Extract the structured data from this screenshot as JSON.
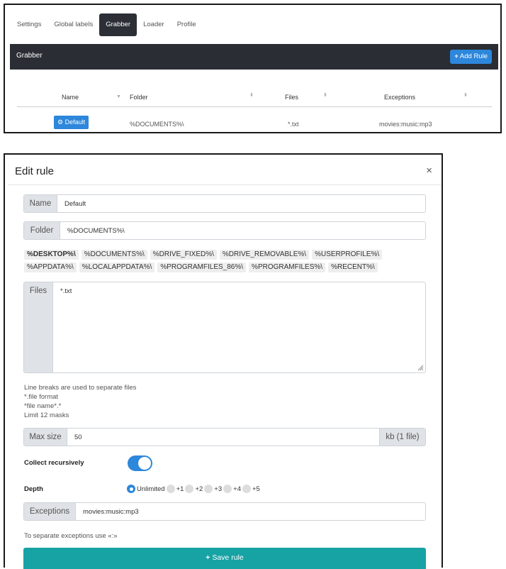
{
  "tabs": [
    "Settings",
    "Global labels",
    "Grabber",
    "Loader",
    "Profile"
  ],
  "active_tab": "Grabber",
  "panel": {
    "title": "Grabber",
    "add_rule": "Add Rule"
  },
  "table": {
    "columns": [
      "Name",
      "Folder",
      "Files",
      "Exceptions"
    ],
    "rows": [
      {
        "name": "Default",
        "folder": "%DOCUMENTS%\\",
        "files": "*.txt",
        "exceptions": "movies:music:mp3"
      }
    ]
  },
  "modal": {
    "title": "Edit rule",
    "close": "×",
    "name_label": "Name",
    "name_value": "Default",
    "folder_label": "Folder",
    "folder_value": "%DOCUMENTS%\\",
    "variables": [
      "%DESKTOP%\\",
      "%DOCUMENTS%\\",
      "%DRIVE_FIXED%\\",
      "%DRIVE_REMOVABLE%\\",
      "%USERPROFILE%\\",
      "%APPDATA%\\",
      "%LOCALAPPDATA%\\",
      "%PROGRAMFILES_86%\\",
      "%PROGRAMFILES%\\",
      "%RECENT%\\"
    ],
    "files_label": "Files",
    "files_value": "*.txt",
    "files_help": [
      "Line breaks are used to separate files",
      "*.file format",
      "*file name*.*",
      "Limit 12 masks"
    ],
    "max_size_label": "Max size",
    "max_size_value": "50",
    "max_size_unit": "kb (1 file)",
    "collect_label": "Collect recursively",
    "collect_on": true,
    "depth_label": "Depth",
    "depth_options": [
      "Unlimited",
      "+1",
      "+2",
      "+3",
      "+4",
      "+5"
    ],
    "depth_selected": "Unlimited",
    "exceptions_label": "Exceptions",
    "exceptions_value": "movies:music:mp3",
    "exceptions_help": "To separate exceptions use «:»",
    "save": "Save rule"
  },
  "colors": {
    "accent": "#2d87db",
    "dark_header": "#2a2d34",
    "save": "#17a2a4"
  }
}
